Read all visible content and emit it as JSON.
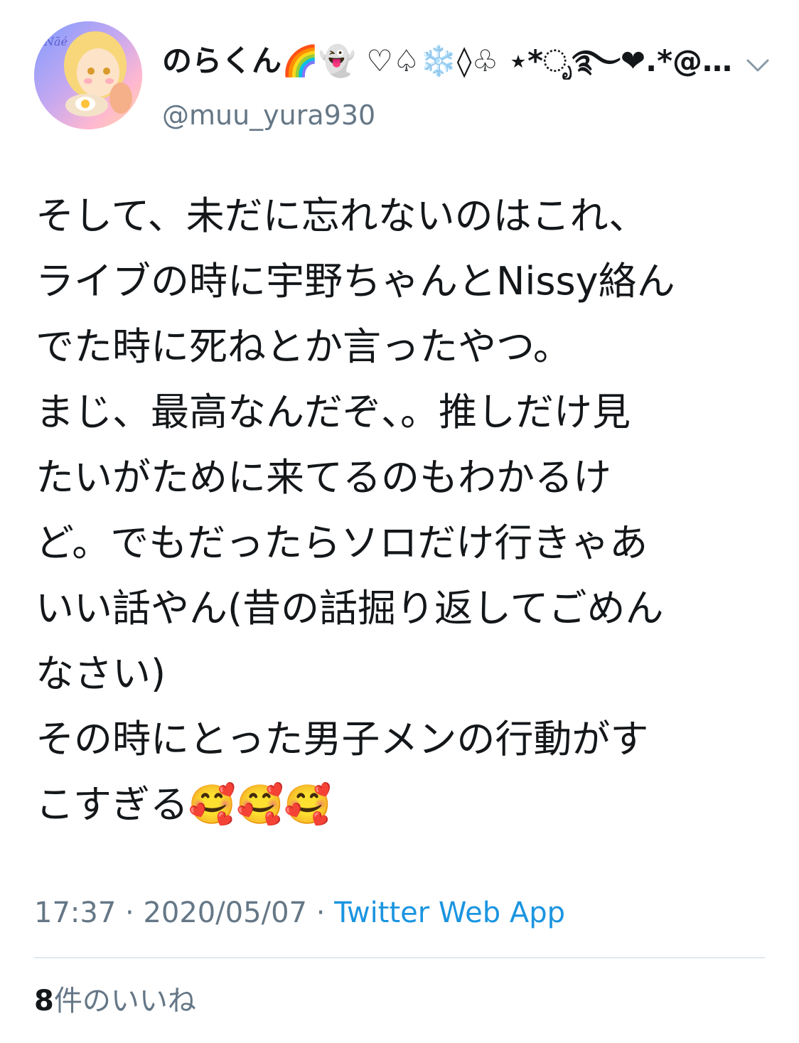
{
  "tweet": {
    "author": {
      "display_name": "のらくん🌈👻 ♡♤❄️◊♧ ⋆*ೃ࿐❤︎.*@…",
      "handle": "@muu_yura930",
      "avatar_icon": "user-avatar-illustration"
    },
    "text_lines": [
      "そして、未だに忘れないのはこれ、",
      "ライブの時に宇野ちゃんとNissy絡ん",
      "でた時に死ねとか言ったやつ。",
      "まじ、最高なんだぞ、。推しだけ見",
      "たいがために来てるのもわかるけ",
      "ど。でもだったらソロだけ行きゃあ",
      "いい話やん(昔の話掘り返してごめん",
      "なさい)",
      "その時にとった男子メンの行動がす",
      "こすぎる🥰🥰🥰"
    ],
    "time": "17:37",
    "separator": "·",
    "date": "2020/05/07",
    "source": "Twitter Web App",
    "likes_count": "8",
    "likes_label": "件のいいね"
  },
  "colors": {
    "text": "#14171a",
    "secondary": "#657786",
    "link": "#1b95e0",
    "divider": "#e1e8ed"
  },
  "icons": {
    "menu": "chevron-down-icon"
  }
}
